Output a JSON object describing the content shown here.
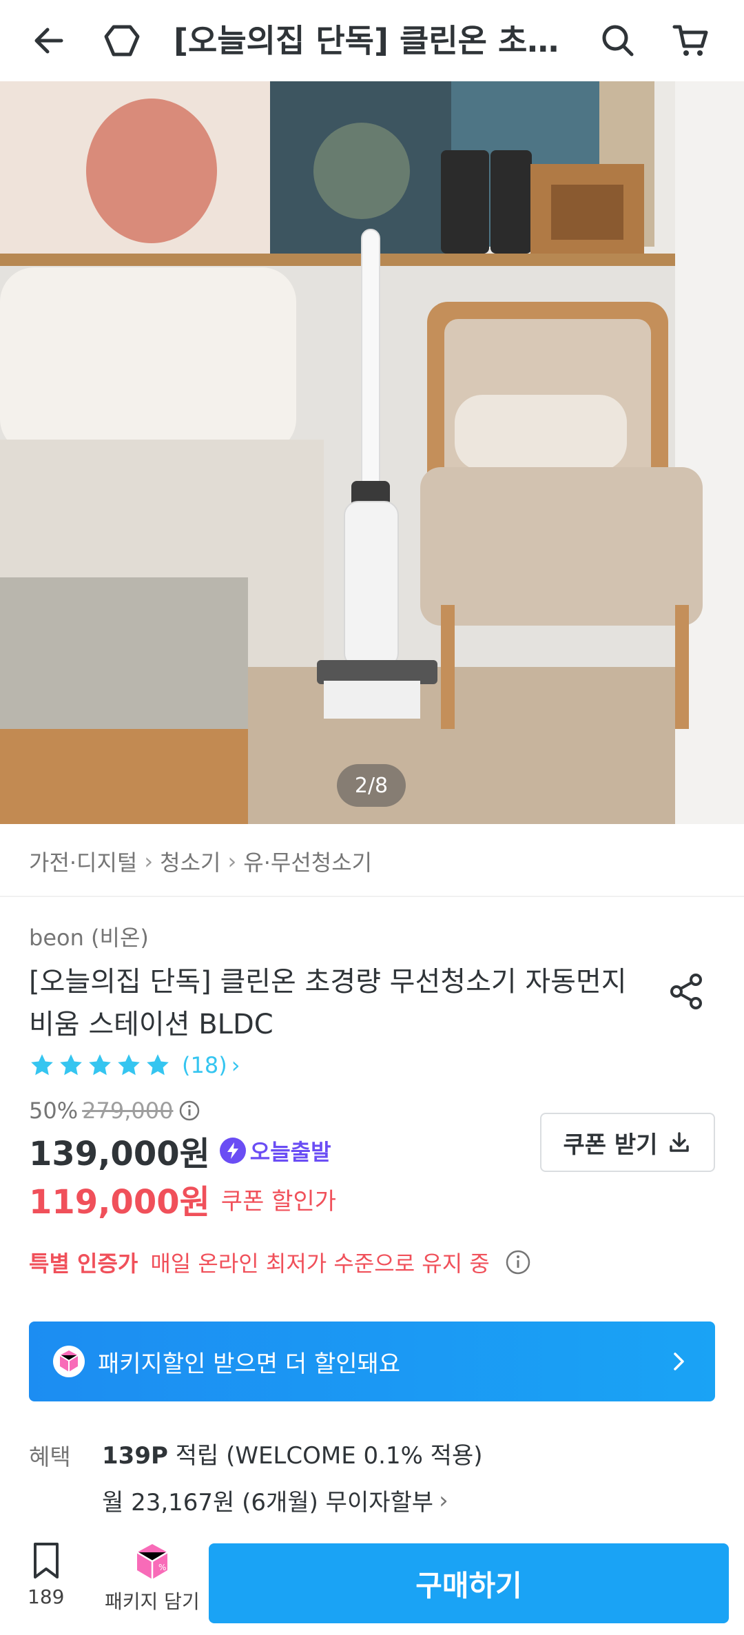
{
  "header": {
    "title": "[오늘의집 단독] 클린온 초경량 무선청소기 자동먼지비움 스테이션 BLDC",
    "icons": [
      "back-arrow-icon",
      "home-icon",
      "search-icon",
      "cart-icon"
    ]
  },
  "gallery": {
    "counter": "2/8"
  },
  "breadcrumb": [
    "가전·디지털",
    "청소기",
    "유·무선청소기"
  ],
  "product": {
    "brand": "beon (비온)",
    "title": "[오늘의집 단독] 클린온 초경량 무선청소기 자동먼지비움 스테이션 BLDC",
    "rating_stars": 5,
    "review_count": "(18)",
    "discount_pct": "50%",
    "original_price": "279,000",
    "price": "139,000원",
    "today_badge": "오늘출발",
    "coupon_price": "119,000원",
    "coupon_price_label": "쿠폰 할인가",
    "coupon_button": "쿠폰 받기",
    "special_label": "특별 인증가",
    "special_desc": "매일 온라인 최저가 수준으로 유지 중"
  },
  "package_banner": {
    "text": "패키지할인 받으면 더 할인돼요"
  },
  "benefits": {
    "label": "혜택",
    "points_bold": "139P",
    "points_rest": " 적립 (WELCOME 0.1% 적용)",
    "installment": "월 23,167원 (6개월) 무이자할부"
  },
  "bottom_bar": {
    "bookmark_count": "189",
    "package_label": "패키지 담기",
    "buy_label": "구매하기"
  },
  "colors": {
    "accent_blue": "#1aa3f5",
    "star_blue": "#35c5f0",
    "sale_red": "#f0505a",
    "badge_purple": "#6a4df4"
  }
}
